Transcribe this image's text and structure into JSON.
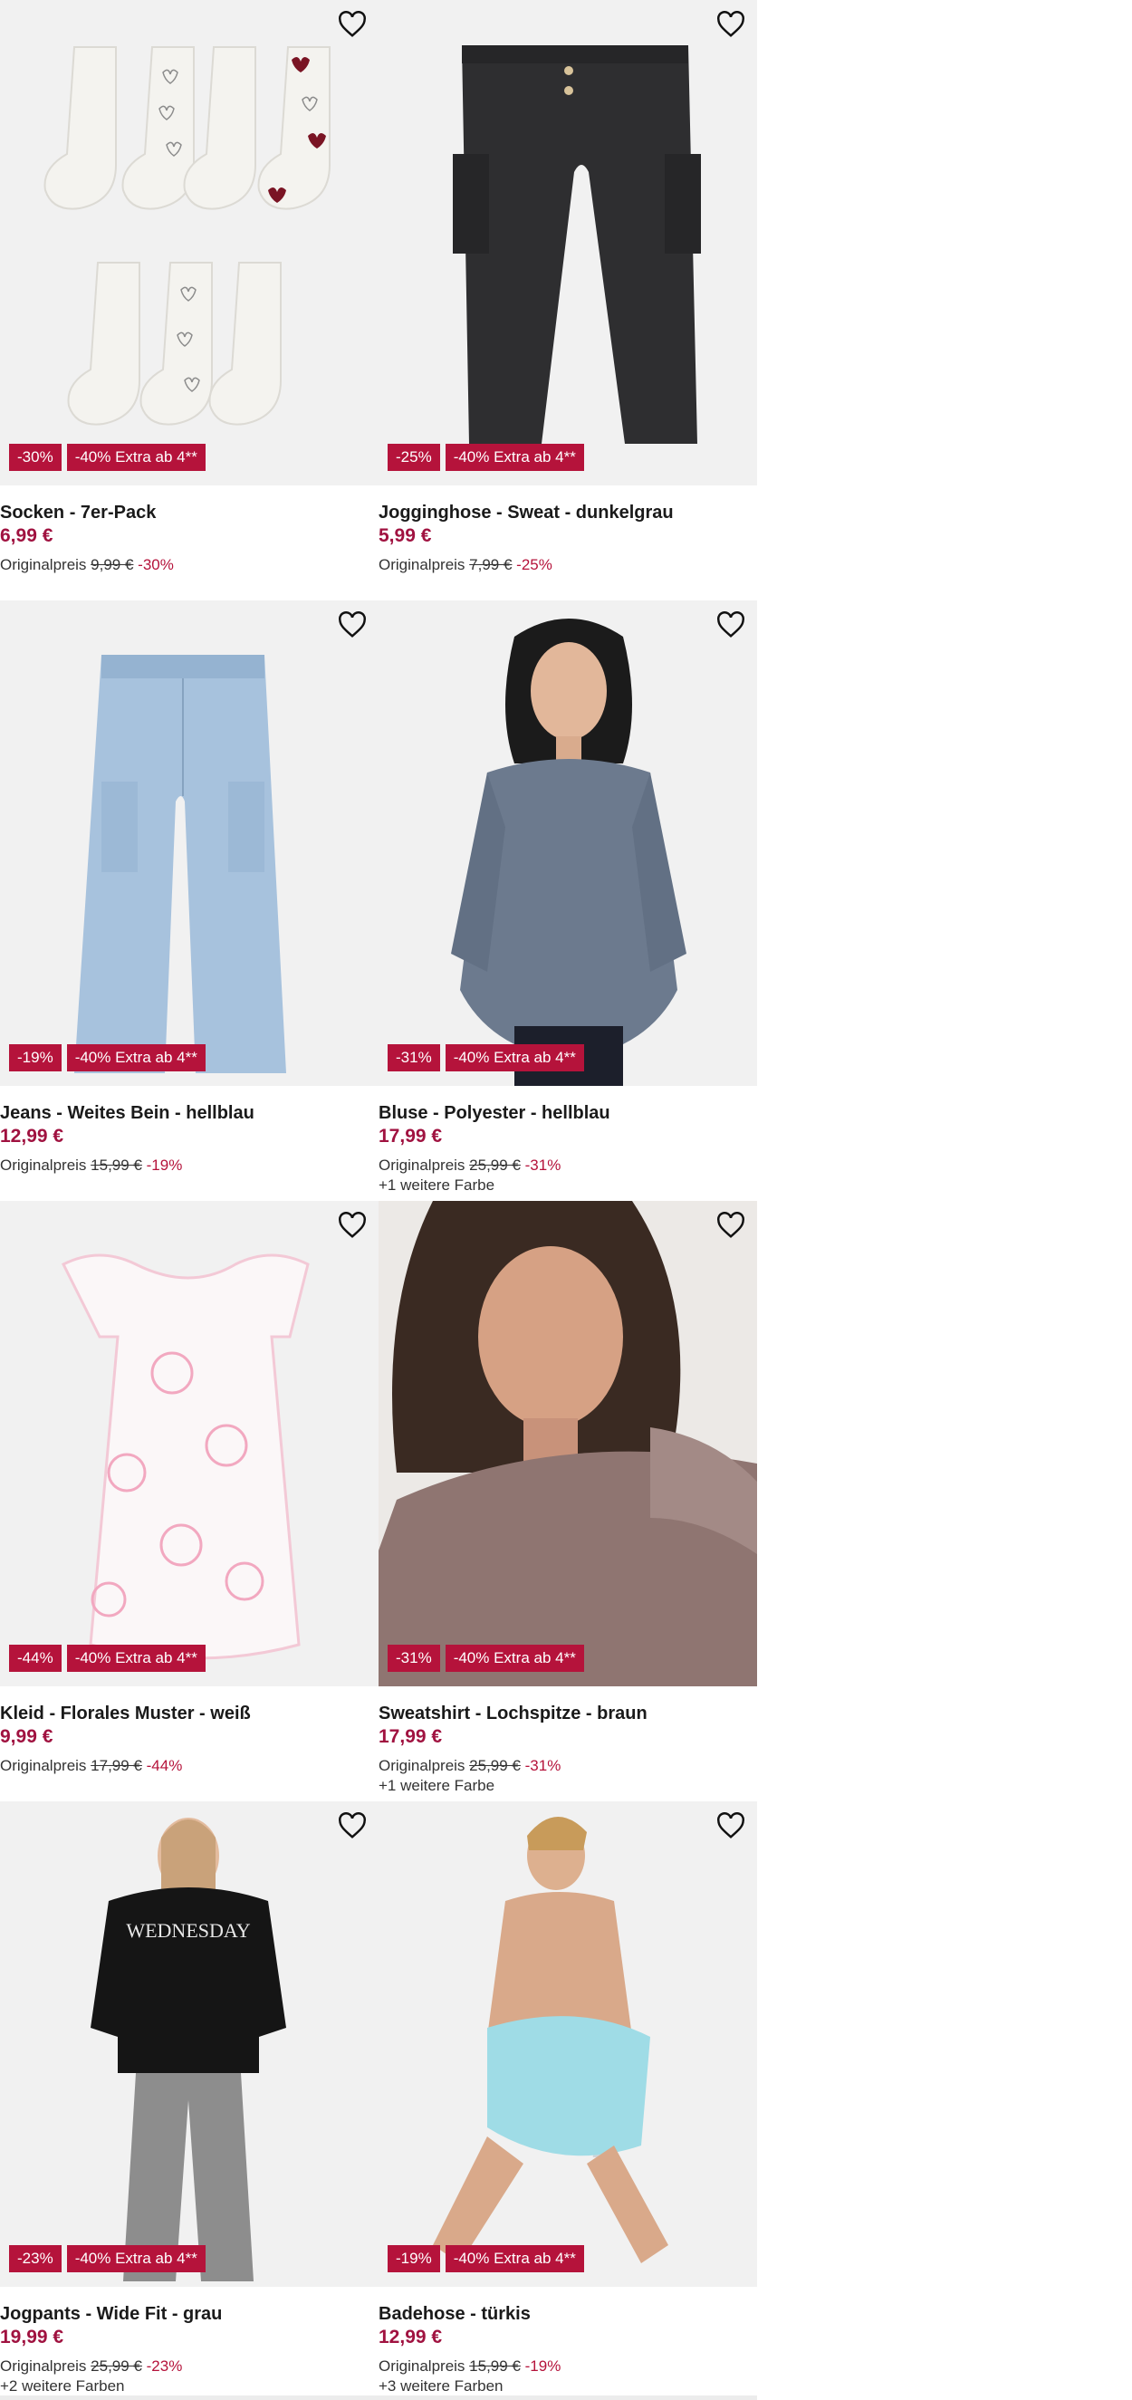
{
  "accent_color": "#b5133b",
  "price_color": "#a01240",
  "products": [
    {
      "name": "Socken - 7er-Pack",
      "price": "6,99 €",
      "orig_label": "Originalpreis",
      "orig_price": "9,99 €",
      "discount": "-30%",
      "badges": [
        "-30%",
        "-40% Extra ab 4**"
      ],
      "colors_note": "",
      "image": "socks-7-pack"
    },
    {
      "name": "Jogginghose - Sweat - dunkelgrau",
      "price": "5,99 €",
      "orig_label": "Originalpreis",
      "orig_price": "7,99 €",
      "discount": "-25%",
      "badges": [
        "-25%",
        "-40% Extra ab 4**"
      ],
      "colors_note": "",
      "image": "dark-grey-sweatpants"
    },
    {
      "name": "Jeans - Weites Bein - hellblau",
      "price": "12,99 €",
      "orig_label": "Originalpreis",
      "orig_price": "15,99 €",
      "discount": "-19%",
      "badges": [
        "-19%",
        "-40% Extra ab 4**"
      ],
      "colors_note": "",
      "image": "light-blue-wide-jeans"
    },
    {
      "name": "Bluse - Polyester - hellblau",
      "price": "17,99 €",
      "orig_label": "Originalpreis",
      "orig_price": "25,99 €",
      "discount": "-31%",
      "badges": [
        "-31%",
        "-40% Extra ab 4**"
      ],
      "colors_note": "+1 weitere Farbe",
      "image": "model-blue-blouse"
    },
    {
      "name": "Kleid - Florales Muster - weiß",
      "price": "9,99 €",
      "orig_label": "Originalpreis",
      "orig_price": "17,99 €",
      "discount": "-44%",
      "badges": [
        "-44%",
        "-40% Extra ab 4**"
      ],
      "colors_note": "",
      "image": "white-floral-dress"
    },
    {
      "name": "Sweatshirt - Lochspitze - braun",
      "price": "17,99 €",
      "orig_label": "Originalpreis",
      "orig_price": "25,99 €",
      "discount": "-31%",
      "badges": [
        "-31%",
        "-40% Extra ab 4**"
      ],
      "colors_note": "+1 weitere Farbe",
      "image": "model-brown-sweatshirt"
    },
    {
      "name": "Jogpants - Wide Fit - grau",
      "price": "19,99 €",
      "orig_label": "Originalpreis",
      "orig_price": "25,99 €",
      "discount": "-23%",
      "badges": [
        "-23%",
        "-40% Extra ab 4**"
      ],
      "colors_note": "+2 weitere Farben",
      "image": "model-grey-jogpants",
      "print": "WEDNESDAY"
    },
    {
      "name": "Badehose - türkis",
      "price": "12,99 €",
      "orig_label": "Originalpreis",
      "orig_price": "15,99 €",
      "discount": "-19%",
      "badges": [
        "-19%",
        "-40% Extra ab 4**"
      ],
      "colors_note": "+3 weitere Farben",
      "image": "model-turquoise-swim-shorts"
    }
  ]
}
